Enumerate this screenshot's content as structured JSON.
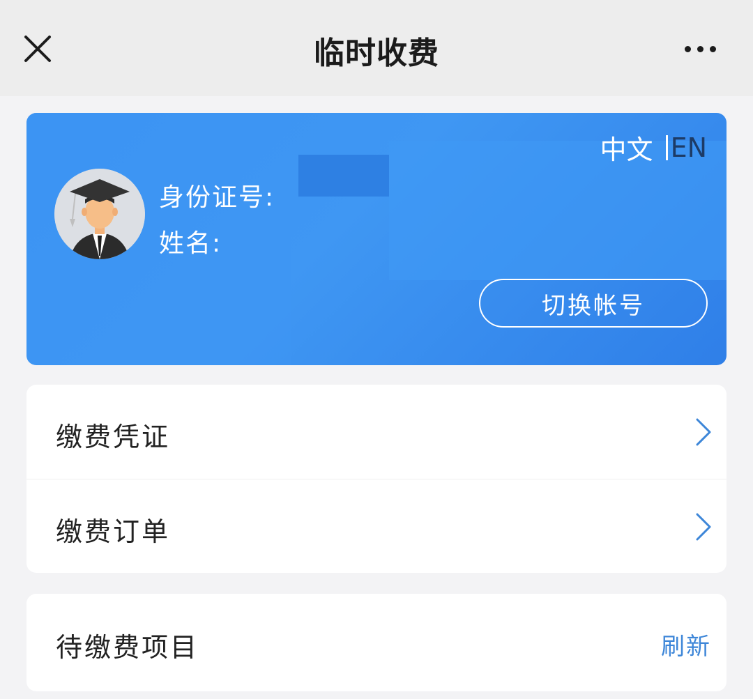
{
  "header": {
    "title": "临时收费",
    "close_icon": "close-icon",
    "more_icon": "more-dots-icon"
  },
  "profile": {
    "lang_zh": "中文",
    "lang_en": "EN",
    "id_label": "身份证号:",
    "name_label": "姓名:",
    "switch_account_label": "切换帐号",
    "avatar_icon": "graduate-avatar-icon",
    "card_color": "#3a92f2"
  },
  "menu": {
    "items": [
      {
        "label": "缴费凭证",
        "icon": "chevron-right-icon"
      },
      {
        "label": "缴费订单",
        "icon": "chevron-right-icon"
      }
    ]
  },
  "pending": {
    "label": "待缴费项目",
    "refresh_label": "刷新",
    "link_color": "#3d86d8"
  }
}
